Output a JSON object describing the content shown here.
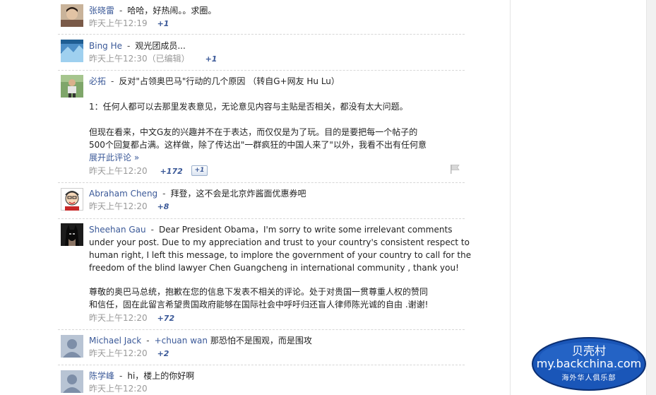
{
  "comments": [
    {
      "author": "张晓雷",
      "text": "哈哈，好热闹。。求圈。",
      "time": "昨天上午12:19",
      "plus": "+1"
    },
    {
      "author": "Bing He",
      "text": "观光团成员...",
      "time": "昨天上午12:30（已编辑）",
      "plus": "+1"
    },
    {
      "author": "必拓",
      "text": "反对\"占领奥巴马\"行动的几个原因 （转自G+网友 Hu Lu）",
      "body": [
        "1：任何人都可以去那里发表意见，无论意见内容与主贴是否相关，都没有太大问题。",
        "但现在看来，中文G友的兴趣并不在于表达，而仅仅是为了玩。目的是要把每一个帖子的",
        "500个回复都占满。这样做，除了传达出\"一群疯狂的中国人来了\"以外，我看不出有任何意"
      ],
      "expand": "展开此评论 »",
      "time": "昨天上午12:20",
      "plus": "+172",
      "plus_button": "+1"
    },
    {
      "author": "Abraham Cheng",
      "text": "拜登，这不会是北京炸酱面优惠券吧",
      "time": "昨天上午12:20",
      "plus": "+8"
    },
    {
      "author": "Sheehan Gau",
      "text": "Dear President Obama，I'm sorry to write some irrelevant comments",
      "body": [
        "under your post. Due to my appreciation and trust to your country's consistent respect to",
        "human right, I left this message, to implore the government of your country to call for the",
        "freedom of the blind lawyer Chen Guangcheng in international community , thank you!",
        "",
        "尊敬的奥巴马总统，抱歉在您的信息下发表不相关的评论。处于对贵国一贯尊重人权的赞同",
        "和信任，固在此留言希望贵国政府能够在国际社会中呼吁归还盲人律师陈光诚的自由 .谢谢!"
      ],
      "time": "昨天上午12:20",
      "plus": "+72"
    },
    {
      "author": "Michael Jack",
      "mention": "+chuan wan",
      "text": "那恐怕不是围观，而是围攻",
      "time": "昨天上午12:20",
      "plus": "+2"
    },
    {
      "author": "陈学峰",
      "text": "hi，楼上的你好啊",
      "time": "昨天上午12:20"
    }
  ],
  "separator": "-",
  "watermark": {
    "line1": "贝壳村",
    "line2": "my.backchina.com",
    "line3": "海外华人俱乐部"
  },
  "colors": {
    "link": "#3b5998",
    "meta": "#999999",
    "badge": "#1a56b8"
  }
}
